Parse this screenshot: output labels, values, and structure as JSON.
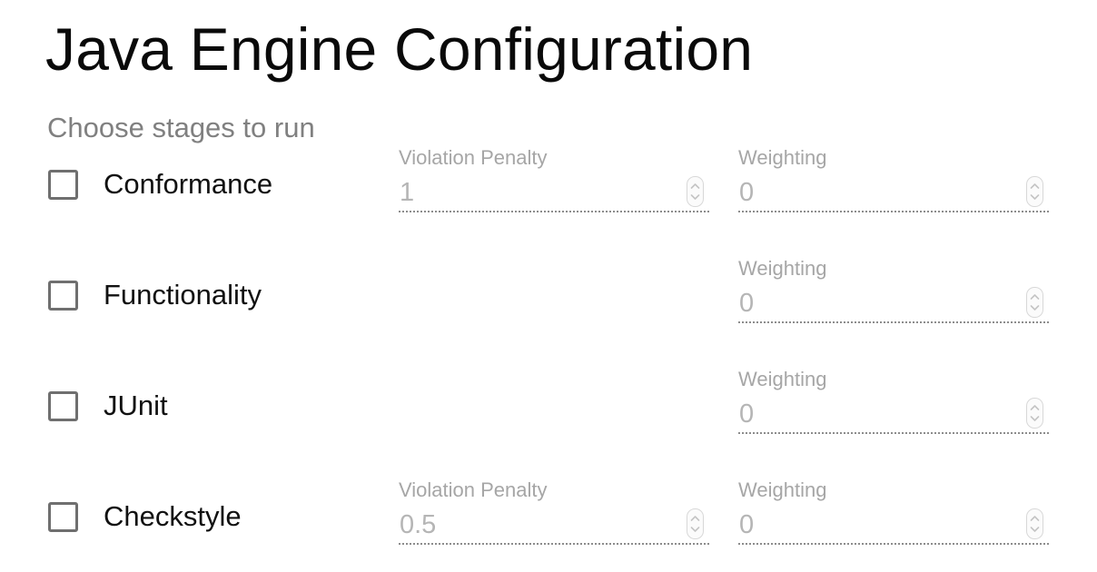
{
  "page": {
    "title": "Java Engine Configuration",
    "stages_heading": "Choose stages to run"
  },
  "stages": [
    {
      "label": "Conformance",
      "checked": false,
      "violation_penalty": {
        "label": "Violation Penalty",
        "value": "1"
      },
      "weighting": {
        "label": "Weighting",
        "value": "0"
      }
    },
    {
      "label": "Functionality",
      "checked": false,
      "weighting": {
        "label": "Weighting",
        "value": "0"
      }
    },
    {
      "label": "JUnit",
      "checked": false,
      "weighting": {
        "label": "Weighting",
        "value": "0"
      }
    },
    {
      "label": "Checkstyle",
      "checked": false,
      "violation_penalty": {
        "label": "Violation Penalty",
        "value": "0.5"
      },
      "weighting": {
        "label": "Weighting",
        "value": "0"
      }
    }
  ],
  "icons": {
    "stepper": "up-down-chevron-icon"
  },
  "colors": {
    "title_text": "#0a0a0a",
    "muted_text": "#808080",
    "disabled_field_label": "#a6a6a6",
    "disabled_field_value": "#b5b5b5",
    "checkbox_border": "#6f6f6f",
    "field_underline": "#8d8d8d"
  }
}
